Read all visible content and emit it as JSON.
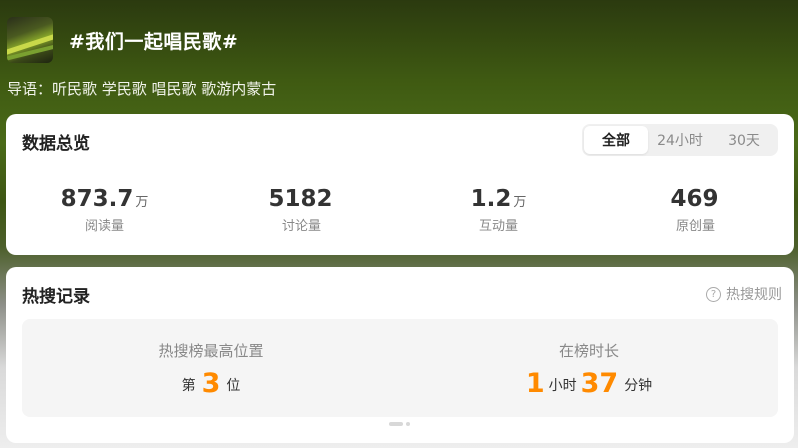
{
  "header": {
    "title": "#我们一起唱民歌#",
    "intro": "导语：听民歌 学民歌 唱民歌 歌游内蒙古"
  },
  "overview": {
    "title": "数据总览",
    "tabs": [
      "全部",
      "24小时",
      "30天"
    ],
    "active_tab": "全部",
    "stats": [
      {
        "value": "873.7",
        "unit": "万",
        "label": "阅读量"
      },
      {
        "value": "5182",
        "unit": "",
        "label": "讨论量"
      },
      {
        "value": "1.2",
        "unit": "万",
        "label": "互动量"
      },
      {
        "value": "469",
        "unit": "",
        "label": "原创量"
      }
    ]
  },
  "hot_search": {
    "title": "热搜记录",
    "rules_label": "热搜规则",
    "rules_icon": "question-circle-icon",
    "highest_position": {
      "label": "热搜榜最高位置",
      "prefix": "第",
      "value": "3",
      "suffix": "位"
    },
    "duration": {
      "label": "在榜时长",
      "hours": "1",
      "hours_unit": "小时",
      "minutes": "37",
      "minutes_unit": "分钟"
    }
  },
  "colors": {
    "accent": "#ff8a00",
    "card_bg": "#ffffff",
    "record_bg": "#f5f5f5"
  }
}
